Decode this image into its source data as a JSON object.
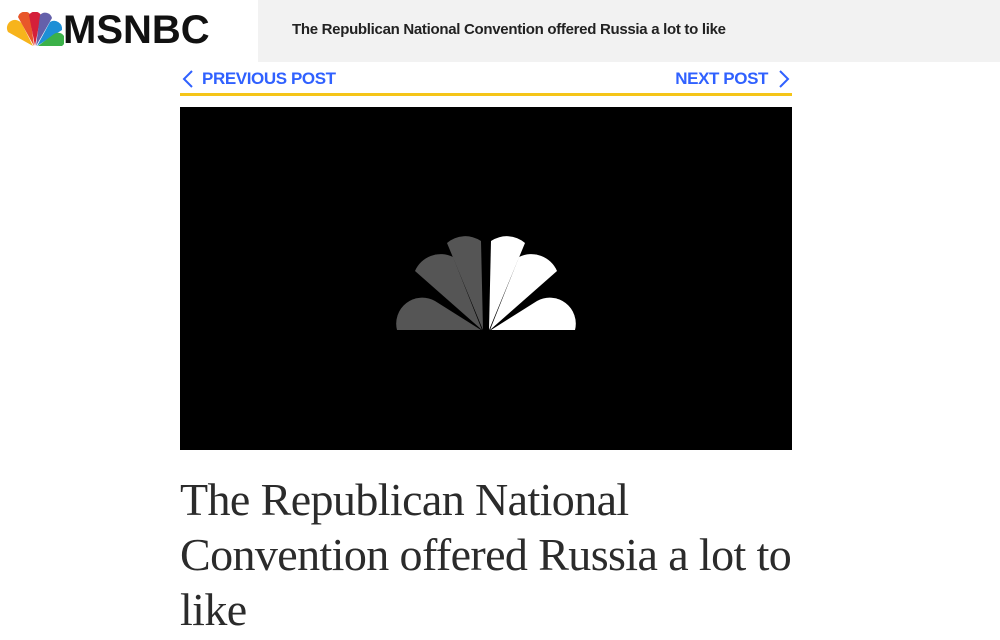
{
  "brand": {
    "name": "MSNBC",
    "peacock_colors": [
      "#f7b41c",
      "#e8572a",
      "#d51f3a",
      "#6460aa",
      "#1e8fd6",
      "#3bb149"
    ]
  },
  "header": {
    "headline": "The Republican National Convention offered Russia a lot to like"
  },
  "post_nav": {
    "previous_label": "PREVIOUS POST",
    "next_label": "NEXT POST",
    "link_color": "#3061ff",
    "rule_color": "#f5c518"
  },
  "video": {
    "logo_icon": "nbc-peacock-icon"
  },
  "article": {
    "title": "The Republican National Convention offered Russia a lot to like"
  }
}
